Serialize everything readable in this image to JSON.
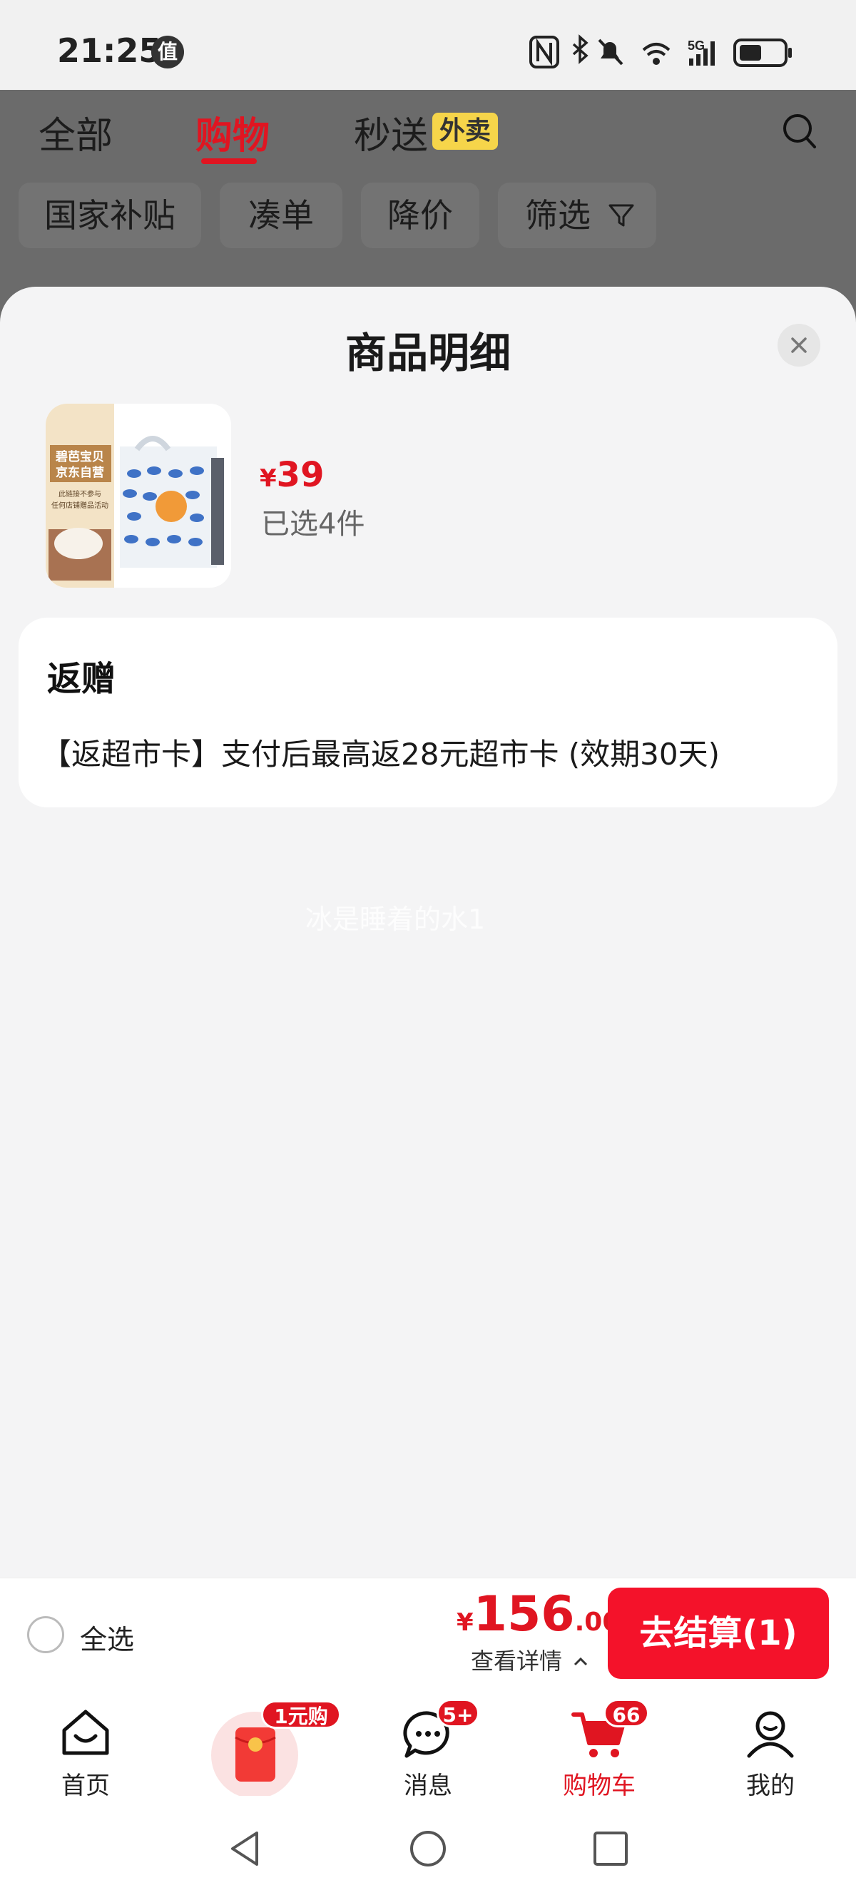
{
  "status_bar": {
    "time": "21:25",
    "app_badge": "值"
  },
  "top_tabs": [
    {
      "label": "全部"
    },
    {
      "label": "购物"
    },
    {
      "label": "秒送"
    }
  ],
  "waimai_badge": "外卖",
  "filter_chips": [
    {
      "label": "国家补贴"
    },
    {
      "label": "凑单"
    },
    {
      "label": "降价"
    },
    {
      "label": "筛选"
    }
  ],
  "sheet": {
    "title": "商品明细",
    "product": {
      "image_text": [
        "碧芭宝贝",
        "京东自营",
        "此链接不参与",
        "任何店铺赠品活动"
      ],
      "price_symbol": "¥",
      "price": "39",
      "selected_count": "已选4件"
    },
    "rebate_card": {
      "title": "返赠",
      "text": "【返超市卡】支付后最高返28元超市卡 (效期30天)"
    },
    "watermark": "冰是睡着的水1"
  },
  "checkout": {
    "select_all_label": "全选",
    "total_symbol": "¥",
    "total_int": "156",
    "total_dec": ".00",
    "detail_label": "查看详情",
    "pay_button": "去结算(1)"
  },
  "bottom_nav": [
    {
      "label": "首页"
    },
    {
      "label": "",
      "badge": "1元购"
    },
    {
      "label": "消息",
      "badge": "5+"
    },
    {
      "label": "购物车",
      "badge": "66"
    },
    {
      "label": "我的"
    }
  ],
  "colors": {
    "accent": "#e01521",
    "pay_button": "#f4122a",
    "overlay": "#6b6b6b",
    "waimai_badge_bg": "#f6d54a"
  }
}
